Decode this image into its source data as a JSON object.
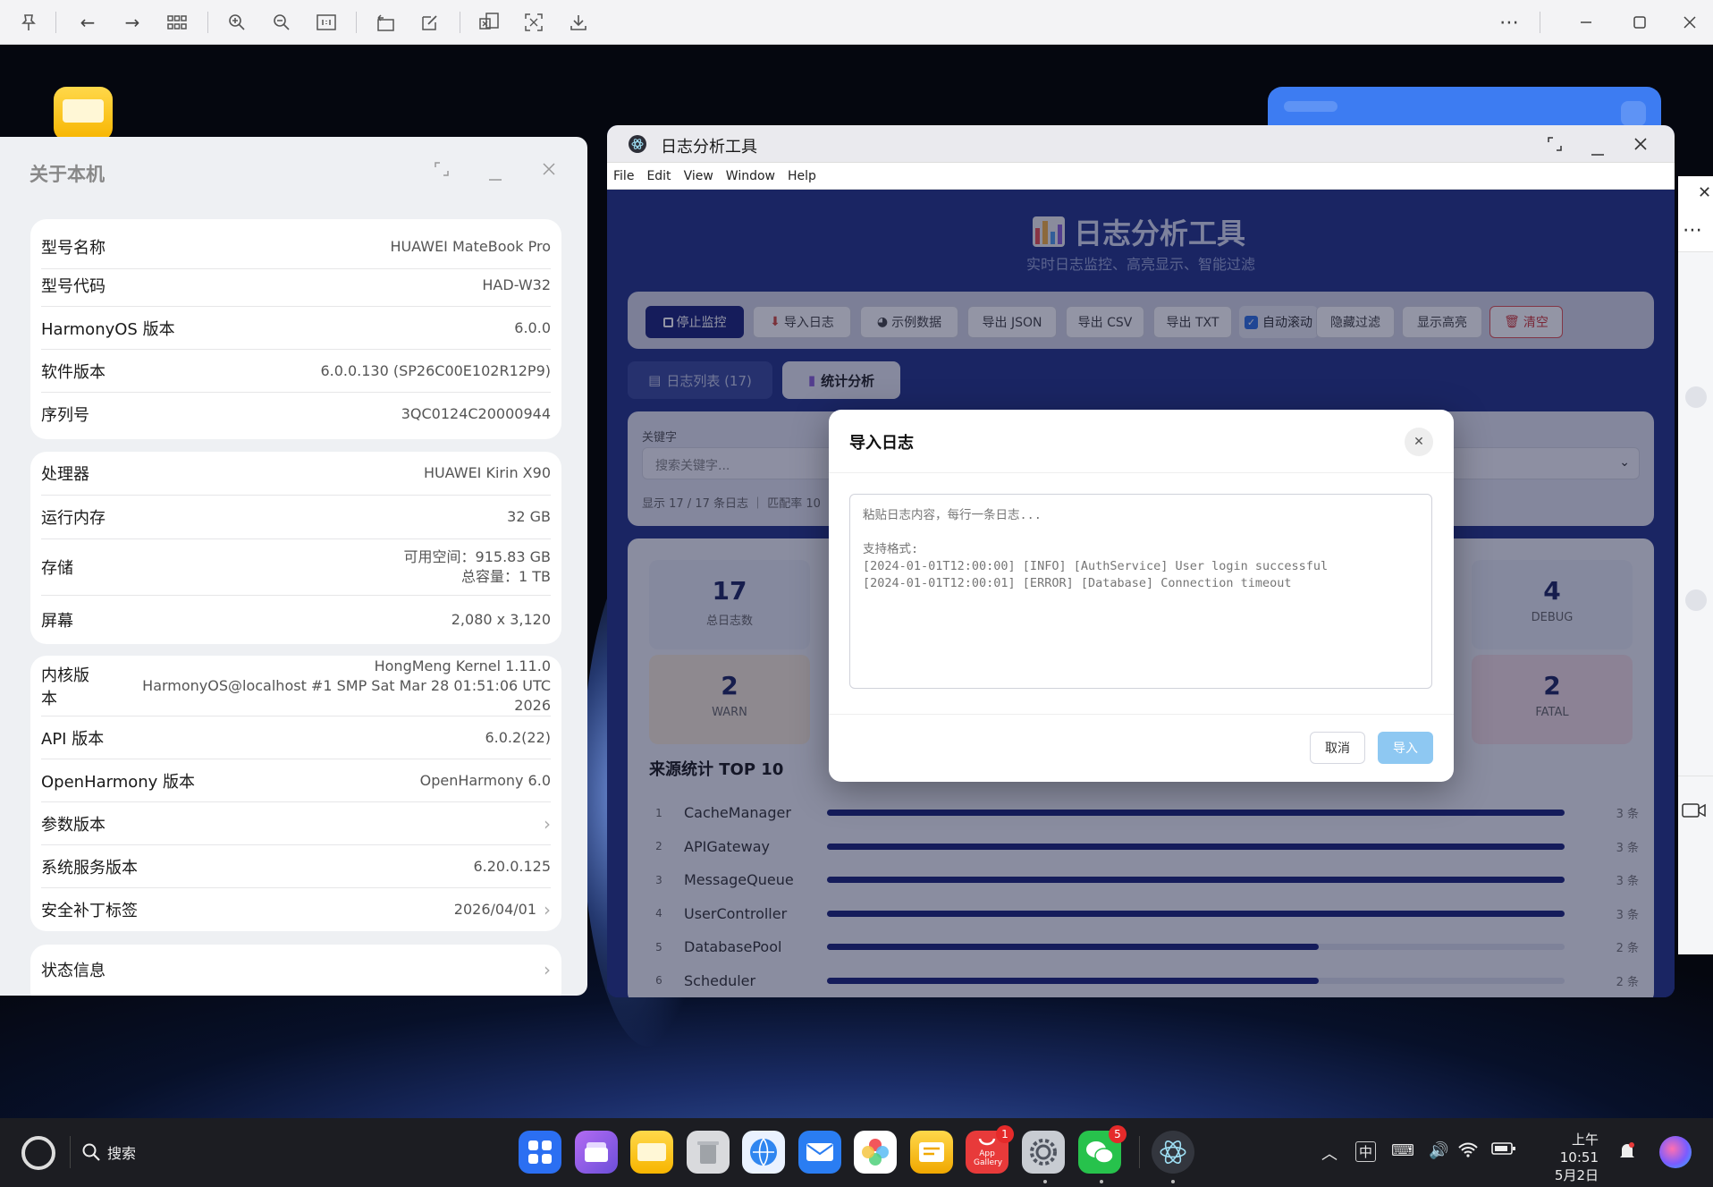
{
  "about": {
    "title": "关于本机",
    "card1": [
      {
        "k": "型号名称",
        "v": "HUAWEI MateBook Pro"
      },
      {
        "k": "型号代码",
        "v": "HAD-W32"
      },
      {
        "k": "HarmonyOS 版本",
        "v": "6.0.0"
      },
      {
        "k": "软件版本",
        "v": "6.0.0.130 (SP26C00E102R12P9)"
      },
      {
        "k": "序列号",
        "v": "3QC0124C20000944"
      }
    ],
    "card2": [
      {
        "k": "处理器",
        "v": "HUAWEI Kirin X90"
      },
      {
        "k": "运行内存",
        "v": "32 GB"
      },
      {
        "k": "存储",
        "v": "可用空间：915.83 GB",
        "v2": "总容量：1 TB"
      },
      {
        "k": "屏幕",
        "v": "2,080 x 3,120"
      }
    ],
    "card3": [
      {
        "k": "内核版本",
        "v": "HongMeng Kernel 1.11.0",
        "v2": "HarmonyOS@localhost #1 SMP Sat Mar 28 01:51:06 UTC 2026"
      },
      {
        "k": "API 版本",
        "v": "6.0.2(22)"
      },
      {
        "k": "OpenHarmony 版本",
        "v": "OpenHarmony 6.0"
      },
      {
        "k": "参数版本",
        "v": ""
      },
      {
        "k": "系统服务版本",
        "v": "6.20.0.125"
      },
      {
        "k": "安全补丁标签",
        "v": "2026/04/01"
      }
    ],
    "card4": [
      {
        "k": "状态信息"
      }
    ]
  },
  "logwin": {
    "title": "日志分析工具",
    "menu": [
      "File",
      "Edit",
      "View",
      "Window",
      "Help"
    ],
    "heading": "日志分析工具",
    "subheading": "实时日志监控、高亮显示、智能过滤",
    "toolbar": {
      "stop": "停止监控",
      "import": "导入日志",
      "sample": "示例数据",
      "json": "导出 JSON",
      "csv": "导出 CSV",
      "txt": "导出 TXT",
      "autoscroll": "自动滚动",
      "hidefilter": "隐藏过滤",
      "highlight": "显示高亮",
      "clear": "清空"
    },
    "tabs": {
      "list": "日志列表 (17)",
      "stats": "统计分析"
    },
    "filter": {
      "label": "关键字",
      "placeholder": "搜索关键字...",
      "status": "显示 17 / 17 条日志 ｜ 匹配率 10"
    },
    "stats": [
      {
        "n": "17",
        "l": "总日志数"
      },
      {
        "n": "4",
        "l": "DEBUG"
      },
      {
        "n": "2",
        "l": "WARN"
      },
      {
        "n": "2",
        "l": "FATAL"
      }
    ],
    "source_title": "来源统计 TOP 10",
    "sources": [
      {
        "idx": "1",
        "name": "CacheManager",
        "count": "3 条",
        "fraction": 1.0
      },
      {
        "idx": "2",
        "name": "APIGateway",
        "count": "3 条",
        "fraction": 1.0
      },
      {
        "idx": "3",
        "name": "MessageQueue",
        "count": "3 条",
        "fraction": 1.0
      },
      {
        "idx": "4",
        "name": "UserController",
        "count": "3 条",
        "fraction": 1.0
      },
      {
        "idx": "5",
        "name": "DatabasePool",
        "count": "2 条",
        "fraction": 0.667
      },
      {
        "idx": "6",
        "name": "Scheduler",
        "count": "2 条",
        "fraction": 0.667
      }
    ]
  },
  "dialog": {
    "title": "导入日志",
    "placeholder": "粘贴日志内容，每行一条日志...\n\n支持格式:\n[2024-01-01T12:00:00] [INFO] [AuthService] User login successful\n[2024-01-01T12:00:01] [ERROR] [Database] Connection timeout",
    "cancel": "取消",
    "import": "导入"
  },
  "taskbar": {
    "search": "搜索",
    "appgallery_badge": "1",
    "appgallery_label": "App Gallery",
    "wechat_badge": "5",
    "ime": "中",
    "time": "上午10:51",
    "date": "5月2日"
  }
}
